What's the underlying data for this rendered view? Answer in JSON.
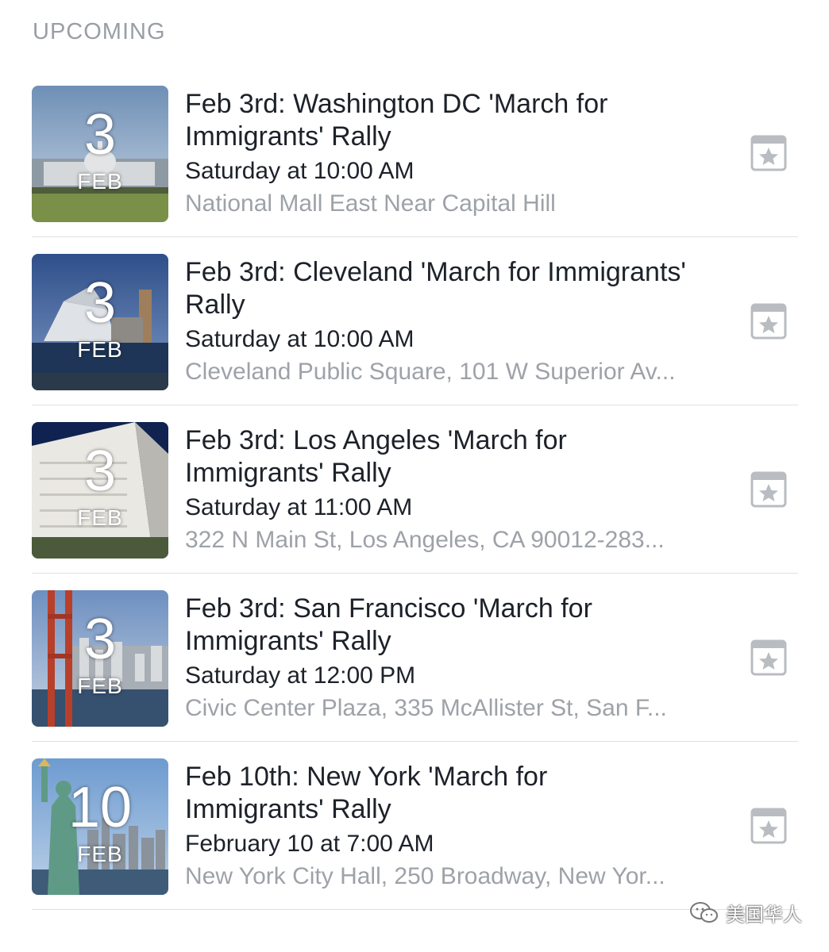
{
  "section_title": "UPCOMING",
  "events": [
    {
      "day": "3",
      "month": "FEB",
      "title": "Feb 3rd: Washington DC 'March for Immigrants' Rally",
      "when": "Saturday at 10:00 AM",
      "where": "National Mall East Near Capital Hill",
      "action_icon": "calendar-star-icon"
    },
    {
      "day": "3",
      "month": "FEB",
      "title": "Feb 3rd: Cleveland 'March for Immigrants' Rally",
      "when": "Saturday at 10:00 AM",
      "where": "Cleveland Public Square, 101 W Superior Av...",
      "action_icon": "calendar-star-icon"
    },
    {
      "day": "3",
      "month": "FEB",
      "title": "Feb 3rd: Los Angeles 'March for Immigrants' Rally",
      "when": "Saturday at 11:00 AM",
      "where": "322 N Main St, Los Angeles, CA 90012-283...",
      "action_icon": "calendar-star-icon"
    },
    {
      "day": "3",
      "month": "FEB",
      "title": "Feb 3rd: San Francisco 'March for Immigrants' Rally",
      "when": "Saturday at 12:00 PM",
      "where": "Civic Center Plaza, 335 McAllister St, San F...",
      "action_icon": "calendar-star-icon"
    },
    {
      "day": "10",
      "month": "FEB",
      "title": "Feb 10th: New York 'March for Immigrants' Rally",
      "when": "February 10 at 7:00 AM",
      "where": "New York City Hall, 250 Broadway, New Yor...",
      "action_icon": "calendar-star-icon"
    }
  ],
  "watermark": "美国华人",
  "colors": {
    "primary_text": "#1d2129",
    "secondary_text": "#9ea2a8",
    "header_text": "#9a9ea5",
    "icon_gray": "#b9bcc1"
  }
}
